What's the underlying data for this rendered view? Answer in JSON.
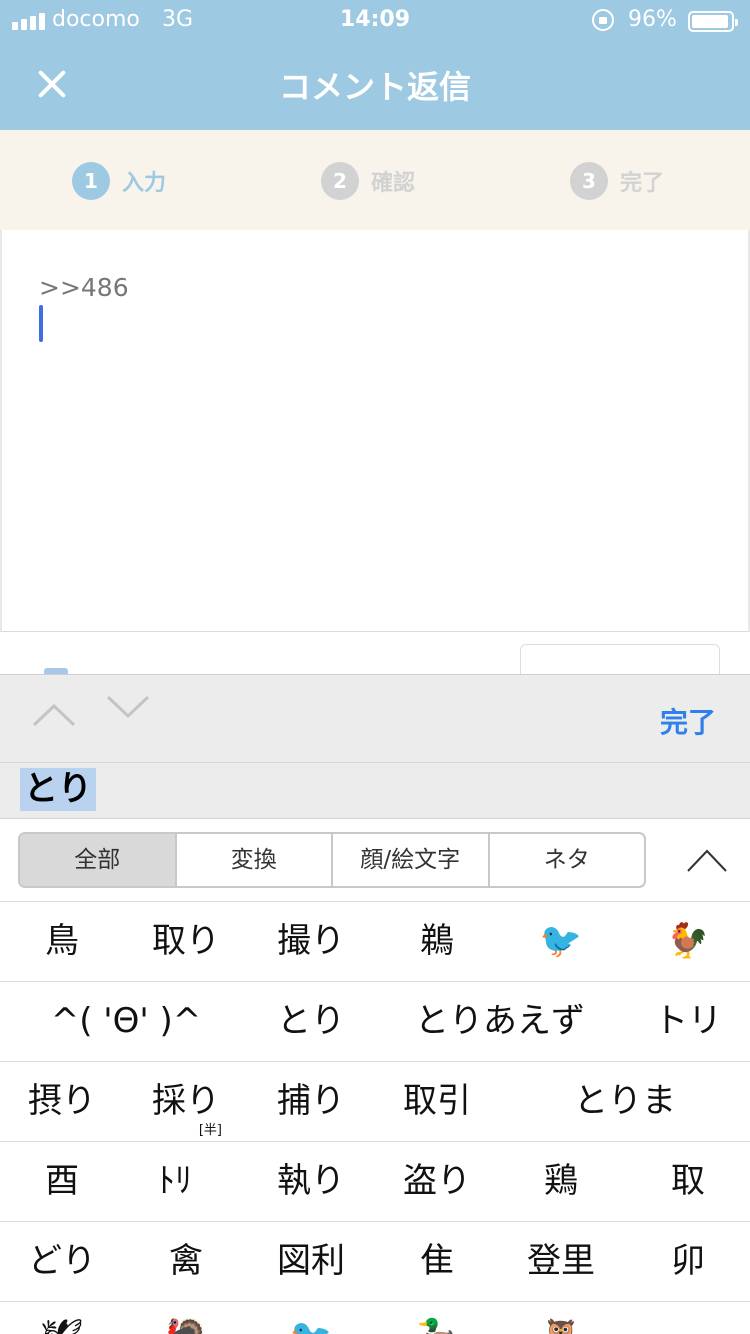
{
  "status": {
    "carrier": "docomo",
    "network": "3G",
    "time": "14:09",
    "battery": "96%",
    "battery_level": 0.96
  },
  "nav": {
    "title": "コメント返信"
  },
  "steps": [
    {
      "num": "1",
      "label": "入力"
    },
    {
      "num": "2",
      "label": "確認"
    },
    {
      "num": "3",
      "label": "完了"
    }
  ],
  "editor": {
    "text": ">>486"
  },
  "keyboard": {
    "done": "完了",
    "marked_text": "とり",
    "tabs": [
      "全部",
      "変換",
      "顔/絵文字",
      "ネタ"
    ],
    "rows": [
      [
        "鳥",
        "取り",
        "撮り",
        "鵜",
        "🐦",
        "🐓"
      ],
      [
        "^( 'Θ' )^",
        "とり",
        "とりあえず",
        "トリ"
      ],
      [
        "摂り",
        "採り",
        "捕り",
        "取引",
        "とりま"
      ],
      [
        "酉",
        "ﾄﾘ",
        "執り",
        "盗り",
        "鶏",
        "取"
      ],
      [
        "どり",
        "禽",
        "図利",
        "隹",
        "登里",
        "卯"
      ],
      [
        "🕊",
        "🦃",
        "🐦",
        "🦆",
        "🦉"
      ]
    ],
    "half_width_badge": "[半]"
  },
  "colors": {
    "nav_bg": "#9ec9e2",
    "steps_bg": "#f8f4ec",
    "step_active": "#9ec9e2",
    "step_inactive": "#d2d2d2",
    "link_blue": "#2f80ed",
    "marked_bg": "#b9d2f0"
  }
}
